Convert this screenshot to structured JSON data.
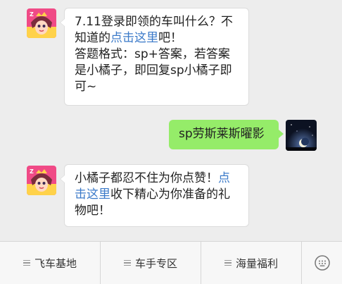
{
  "messages": [
    {
      "direction": "incoming",
      "lines": [
        [
          {
            "text": "7.11登录即领的车叫什么？不"
          }
        ],
        [
          {
            "text": "知道的"
          },
          {
            "text": "点击这里",
            "link": true
          },
          {
            "text": "吧！"
          }
        ],
        [
          {
            "text": "答题格式：sp+答案，若答案"
          }
        ],
        [
          {
            "text": "是小橘子，即回复sp小橘子即"
          }
        ],
        [
          {
            "text": "可~"
          }
        ]
      ]
    },
    {
      "direction": "outgoing",
      "text": "sp劳斯莱斯曜影"
    },
    {
      "direction": "incoming",
      "lines": [
        [
          {
            "text": "小橘子都忍不住为你点赞！"
          },
          {
            "text": "点",
            "link": true
          }
        ],
        [
          {
            "text": "击这里",
            "link": true
          },
          {
            "text": "收下精心为你准备的礼"
          }
        ],
        [
          {
            "text": "物吧！"
          }
        ]
      ]
    }
  ],
  "menu": [
    {
      "label": "飞车基地"
    },
    {
      "label": "车手专区"
    },
    {
      "label": "海量福利"
    }
  ],
  "icons": {
    "official_avatar": "game-character-avatar-icon",
    "user_avatar": "night-moon-avatar-icon",
    "menu": "menu-lines-icon",
    "keyboard": "keyboard-icon"
  },
  "colors": {
    "background": "#ededed",
    "incoming_bubble": "#ffffff",
    "outgoing_bubble": "#95ec69",
    "link": "#3b7ac9"
  }
}
